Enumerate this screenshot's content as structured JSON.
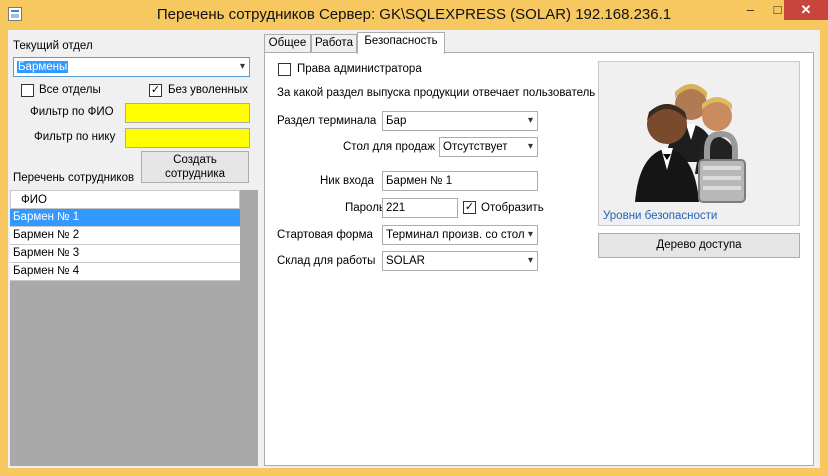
{
  "window": {
    "title": "Перечень сотрудников  Сервер: GK\\SQLEXPRESS (SOLAR) 192.168.236.1",
    "minimize": "–",
    "maximize": "□",
    "close": "✕"
  },
  "left": {
    "department_label": "Текущий отдел",
    "department_value": "Бармены",
    "all_departments_label": "Все отделы",
    "all_departments_checked": false,
    "no_dismissed_label": "Без уволенных",
    "no_dismissed_checked": true,
    "filter_fio_label": "Фильтр по ФИО",
    "filter_fio_value": "",
    "filter_nick_label": "Фильтр по нику",
    "filter_nick_value": "",
    "create_button": "Создать сотрудника",
    "list_label": "Перечень сотрудников",
    "grid": {
      "header": "ФИО",
      "rows": [
        "Бармен № 1",
        "Бармен № 2",
        "Бармен № 3",
        "Бармен № 4"
      ],
      "selected_index": 0
    }
  },
  "tabs": {
    "items": [
      "Общее",
      "Работа",
      "Безопасность"
    ],
    "active": "Безопасность"
  },
  "security": {
    "admin_rights_label": "Права администратора",
    "admin_rights_checked": false,
    "section_question": "За какой раздел выпуска продукции отвечает пользователь",
    "terminal_section_label": "Раздел терминала",
    "terminal_section_value": "Бар",
    "sales_table_label": "Стол для продаж",
    "sales_table_value": "Отсутствует",
    "login_nick_label": "Ник входа",
    "login_nick_value": "Бармен № 1",
    "password_label": "Пароль",
    "password_value": "221",
    "show_password_label": "Отобразить",
    "show_password_checked": true,
    "start_form_label": "Стартовая форма",
    "start_form_value": "Терминал произв. со стол",
    "warehouse_label": "Склад для работы",
    "warehouse_value": "SOLAR",
    "security_levels_link": "Уровни безопасности",
    "access_tree_button": "Дерево доступа"
  },
  "colors": {
    "title_bar": "#f8c860",
    "close_button": "#c7453a",
    "selection": "#3399ff",
    "filter_fill": "#ffff00",
    "grid_background": "#a9a9a9",
    "link": "#1e63b8"
  },
  "icons": {
    "app": "app-icon",
    "image": "users-lock-icon",
    "dropdown": "chevron-down-icon",
    "check": "checkmark-icon"
  }
}
